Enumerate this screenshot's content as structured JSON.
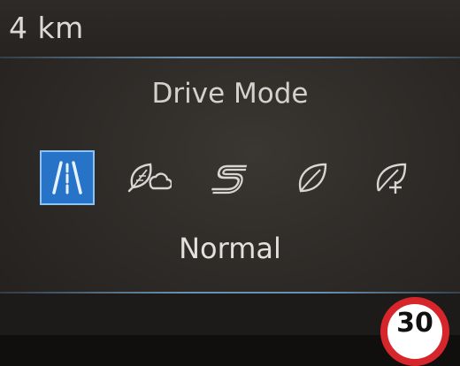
{
  "trip": {
    "distance": "4 km"
  },
  "menu": {
    "title": "Drive Mode",
    "modes": [
      {
        "icon": "road-icon",
        "selected": true
      },
      {
        "icon": "leaf-cloud-icon",
        "selected": false
      },
      {
        "icon": "sport-s-icon",
        "selected": false
      },
      {
        "icon": "leaf-icon",
        "selected": false
      },
      {
        "icon": "leaf-plus-icon",
        "selected": false
      }
    ],
    "selected_label": "Normal"
  },
  "speed_limit": {
    "value": "30"
  },
  "colors": {
    "selected_mode_bg": "#2673c8",
    "speed_sign_ring": "#d7262b"
  }
}
